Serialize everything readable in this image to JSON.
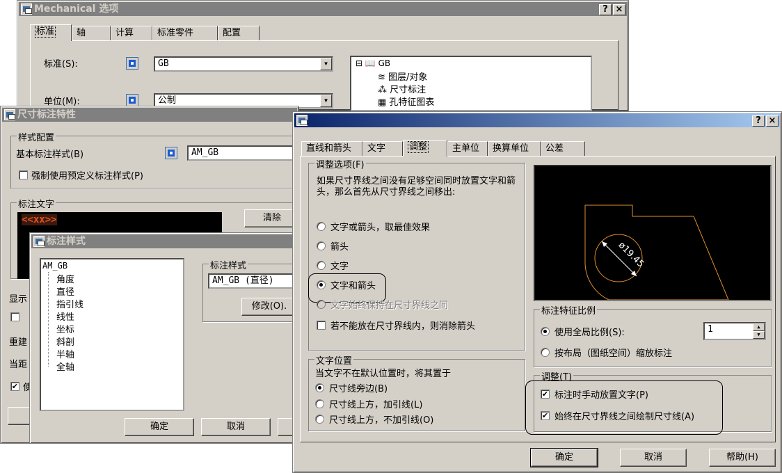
{
  "mech": {
    "title": "Mechanical 选项",
    "tabs": [
      "标准",
      "轴",
      "计算",
      "标准零件",
      "配置"
    ],
    "std_label": "标准(S):",
    "std_value": "GB",
    "unit_label": "单位(M):",
    "unit_value": "公制",
    "tree": [
      "GB",
      "图层/对象",
      "尺寸标注",
      "孔特征图表"
    ]
  },
  "dimprop": {
    "title": "尺寸标注特性",
    "g1": "样式配置",
    "base_label": "基本标注样式(B)",
    "base_value": "AM_GB",
    "force_label": "强制使用预定义标注样式(P)",
    "g2": "标注文字",
    "text_value": "<<xx>>",
    "clear_btn": "清除",
    "l_show": "显示",
    "l_rebuild": "重建",
    "l_current": "当距",
    "l_use": "使"
  },
  "dimstyle": {
    "title": "标注样式",
    "list": [
      "AM_GB",
      "角度",
      "直径",
      "指引线",
      "线性",
      "坐标",
      "斜剖",
      "半轴",
      "全轴"
    ],
    "g": "标注样式",
    "value": "AM_GB (直径)",
    "modify_btn": "修改(O).",
    "ok_btn": "确定",
    "cancel_btn": "取消"
  },
  "adjust": {
    "tabs": [
      "直线和箭头",
      "文字",
      "调整",
      "主单位",
      "换算单位",
      "公差"
    ],
    "opt_group": "调整选项(F)",
    "opt_desc": "如果尺寸界线之间没有足够空间同时放置文字和箭头，那么首先从尺寸界线之间移出:",
    "opts": [
      "文字或箭头，取最佳效果",
      "箭头",
      "文字",
      "文字和箭头",
      "文字始终保持在尺寸界线之间"
    ],
    "suppress": "若不能放在尺寸界线内，则消除箭头",
    "pos_group": "文字位置",
    "pos_desc": "当文字不在默认位置时，将其置于",
    "pos_opts": [
      "尺寸线旁边(B)",
      "尺寸线上方，加引线(L)",
      "尺寸线上方，不加引线(O)"
    ],
    "scale_group": "标注特征比例",
    "scale_global": "使用全局比例(S):",
    "scale_value": "1",
    "scale_layout": "按布局（图纸空间）缩放标注",
    "fine_group": "调整(T)",
    "fine1": "标注时手动放置文字(P)",
    "fine2": "始终在尺寸界线之间绘制尺寸线(A)",
    "preview_text": "ø19.45",
    "ok": "确定",
    "cancel": "取消",
    "help": "帮助(H)"
  },
  "colors": {
    "preview_bg": "#000000",
    "preview_line": "#e0902a",
    "titlebar": "#0a246a"
  }
}
